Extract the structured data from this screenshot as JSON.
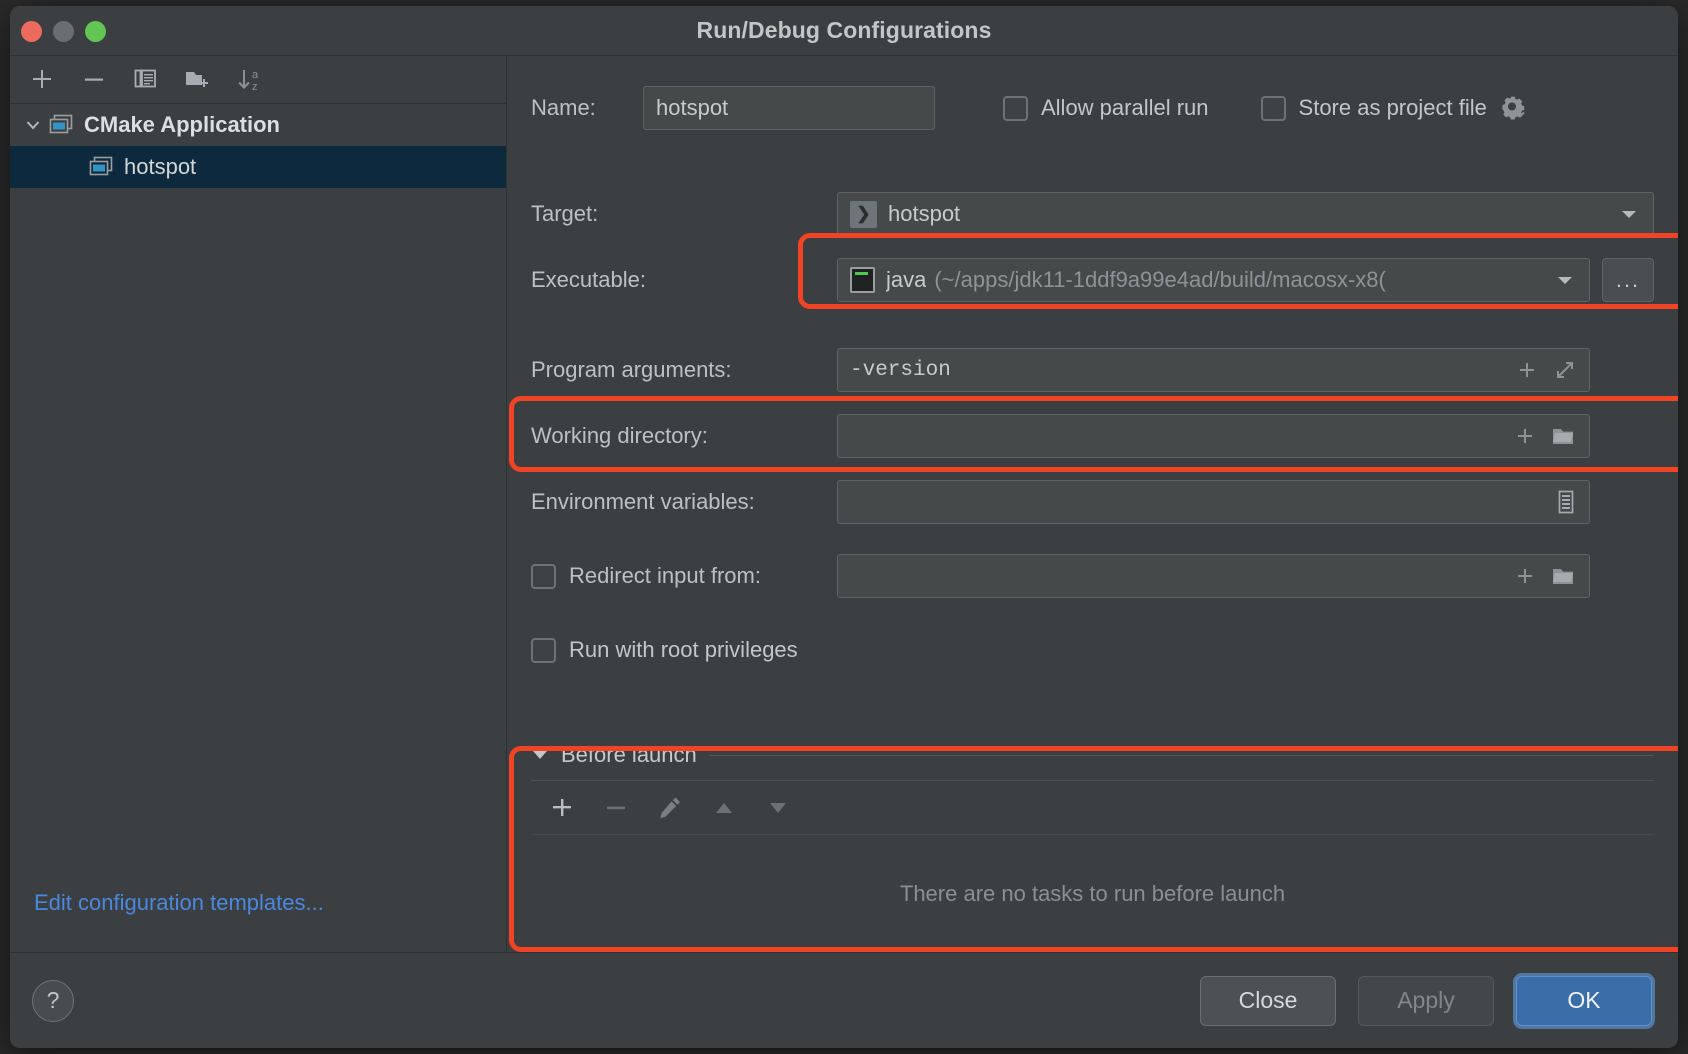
{
  "window": {
    "title": "Run/Debug Configurations",
    "traffic_lights": [
      "close-red",
      "minimize-yellow",
      "maximize-green"
    ]
  },
  "left_panel": {
    "toolbar": [
      {
        "name": "add-configuration-button",
        "icon": "plus-icon",
        "label": "+"
      },
      {
        "name": "remove-configuration-button",
        "icon": "minus-icon",
        "label": "−"
      },
      {
        "name": "copy-configuration-button",
        "icon": "copy-icon",
        "label": ""
      },
      {
        "name": "add-folder-button",
        "icon": "new-folder-icon",
        "label": ""
      },
      {
        "name": "sort-configurations-button",
        "icon": "sort-alphabetically-icon",
        "label": ""
      }
    ],
    "tree": [
      {
        "label": "CMake Application",
        "type": "group",
        "expanded": true,
        "selected": false
      },
      {
        "label": "hotspot",
        "type": "child",
        "selected": true
      }
    ],
    "templates_link": "Edit configuration templates..."
  },
  "form": {
    "name_label": "Name:",
    "name_value": "hotspot",
    "name_placeholder": "Name",
    "allow_parallel_run": {
      "label": "Allow parallel run",
      "checked": false
    },
    "store_as_project_file": {
      "label": "Store as project file",
      "checked": false,
      "gear_icon": "gear-icon"
    },
    "target_label": "Target:",
    "target_value": "hotspot",
    "executable_label": "Executable:",
    "executable_value": "java",
    "executable_path": "(~/apps/jdk11-1ddf9a99e4ad/build/macosx-x8(",
    "executable_browse": "...",
    "program_arguments_label": "Program arguments:",
    "program_arguments_value": "-version",
    "working_directory_label": "Working directory:",
    "working_directory_value": "",
    "environment_variables_label": "Environment variables:",
    "environment_variables_value": "",
    "redirect_input_from": {
      "label": "Redirect input from:",
      "checked": false,
      "value": ""
    },
    "run_with_root_privileges": {
      "label": "Run with root privileges",
      "checked": false
    }
  },
  "before_launch": {
    "caption": "Before launch",
    "expanded": true,
    "toolbar": [
      {
        "name": "add-task-button",
        "icon": "plus-icon"
      },
      {
        "name": "remove-task-button",
        "icon": "minus-icon"
      },
      {
        "name": "edit-task-button",
        "icon": "pencil-icon"
      },
      {
        "name": "move-task-up-button",
        "icon": "triangle-up-icon"
      },
      {
        "name": "move-task-down-button",
        "icon": "triangle-down-icon"
      }
    ],
    "empty_text": "There are no tasks to run before launch"
  },
  "footer": {
    "help_label": "?",
    "close_label": "Close",
    "apply_label": "Apply",
    "ok_label": "OK"
  },
  "colors": {
    "highlight": "#f04424",
    "link": "#4a88e0",
    "primary_button": "#3b6ea8",
    "selection": "#0d293e",
    "panel": "#3c3f41"
  },
  "highlights": [
    {
      "name": "target-field-highlight",
      "target": "target-row"
    },
    {
      "name": "program-arguments-highlight",
      "target": "program-arguments-row"
    },
    {
      "name": "before-launch-highlight",
      "target": "before-launch-section"
    }
  ]
}
